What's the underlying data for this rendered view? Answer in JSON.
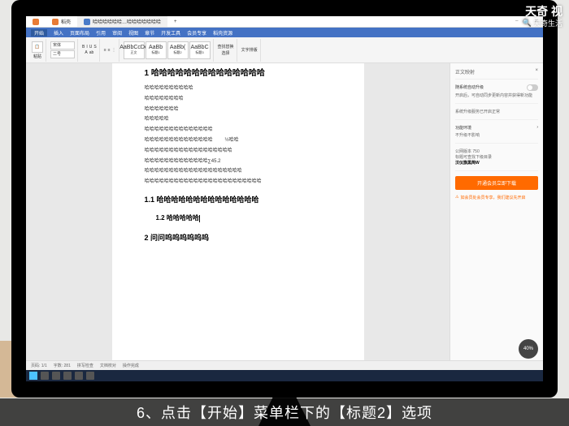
{
  "watermark": {
    "main": "天奇 视",
    "sub": "天奇生活"
  },
  "caption": "6、点击【开始】菜单栏下的【标题2】选项",
  "tabs": {
    "t1": "稻壳",
    "t2": "哈哈哈哈哈哈…哈哈哈哈哈哈哈"
  },
  "menu": {
    "m1": "开始",
    "m2": "插入",
    "m3": "页面布局",
    "m4": "引用",
    "m5": "审阅",
    "m6": "视图",
    "m7": "章节",
    "m8": "开发工具",
    "m9": "会员专享",
    "m10": "稻壳资源"
  },
  "toolbar": {
    "paste": "粘贴",
    "font": "宋体",
    "size": "二号",
    "style1": "AaBbCcDd",
    "style1n": "正文",
    "style2": "AaBb",
    "style2n": "标题1",
    "style3": "AaBb(",
    "style3n": "标题2",
    "style4": "AaBbC",
    "style4n": "标题3",
    "find": "查找替换",
    "select": "选择",
    "settings": "文字排版"
  },
  "document": {
    "h1": "1 哈哈哈哈哈哈哈哈哈哈哈哈哈哈",
    "p1": "哈哈哈哈哈哈哈哈哈哈",
    "p2": "哈哈哈哈哈哈哈哈",
    "p3": "哈哈哈哈哈哈哈",
    "p4": "哈哈哈哈哈",
    "p5": "哈哈哈哈哈哈哈哈哈哈哈哈哈哈",
    "p6": "哈哈哈哈哈哈哈哈哈哈哈哈哈哈",
    "frac": "½哈哈",
    "p7": "哈哈哈哈哈哈哈哈哈哈哈哈哈哈哈哈哈哈",
    "p8": "哈哈哈哈哈哈哈哈哈哈哈哈哈∑45.2",
    "p9": "哈哈哈哈哈哈哈哈哈哈哈哈哈哈哈哈哈哈哈哈",
    "p10": "哈哈哈哈哈哈哈哈哈哈哈哈哈哈哈哈哈哈哈哈哈哈哈哈",
    "h2": "1.1 哈哈哈哈哈哈哈哈哈哈哈哈哈哈",
    "h3": "1.2 哈哈哈哈哈",
    "h4": "2 问问呜呜呜呜呜呜"
  },
  "sidebar": {
    "title": "正文映射",
    "opt1": "随系统自动升级",
    "opt1sub": "开启后，可自动同步更新内容并获得新功能",
    "opt2": "系统升级服务已开启正常",
    "env": "功能环境",
    "envnote": "不升级不影响",
    "info1": "公网版本 750",
    "info2": "标题可查找下级目录",
    "info3": "汉仪旗黑简W",
    "download": "开通会员立即下载",
    "warn": "如会员处会员专享，我们建议先开启"
  },
  "status": {
    "page": "页码: 1/1",
    "words": "字数: 281",
    "check": "拼写检查",
    "proof": "文档校对",
    "done": "操作完成"
  },
  "zoom": "40%"
}
